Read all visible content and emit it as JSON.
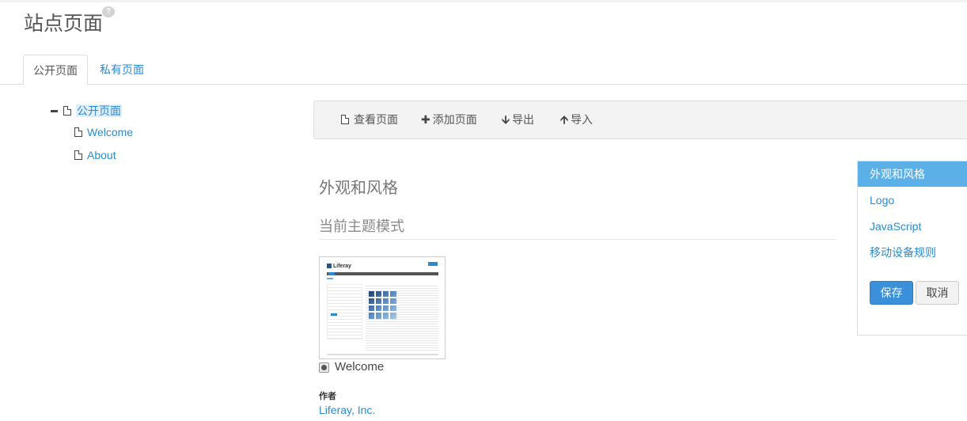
{
  "header": {
    "title": "站点页面",
    "help_icon": "?"
  },
  "tabs": [
    {
      "label": "公开页面",
      "active": true
    },
    {
      "label": "私有页面",
      "active": false
    }
  ],
  "tree": {
    "root": {
      "label": "公开页面",
      "icon": "document-icon",
      "expanded": true
    },
    "children": [
      {
        "label": "Welcome",
        "icon": "document-icon"
      },
      {
        "label": "About",
        "icon": "document-icon"
      }
    ]
  },
  "toolbar": {
    "view_page": {
      "label": "查看页面",
      "icon": "document-icon"
    },
    "add_page": {
      "label": "添加页面",
      "icon": "plus-icon"
    },
    "export": {
      "label": "导出",
      "icon": "arrow-down-icon"
    },
    "import": {
      "label": "导入",
      "icon": "arrow-up-icon"
    }
  },
  "main": {
    "section_title": "外观和风格",
    "subsection_title": "当前主题模式",
    "theme": {
      "name": "Welcome",
      "thumbnail_brand": "Liferay",
      "selected": true
    },
    "author_label": "作者",
    "author_value": "Liferay, Inc."
  },
  "side_panel": {
    "items": [
      {
        "label": "外观和风格",
        "active": true
      },
      {
        "label": "Logo",
        "active": false
      },
      {
        "label": "JavaScript",
        "active": false
      },
      {
        "label": "移动设备规则",
        "active": false
      }
    ],
    "save_label": "保存",
    "cancel_label": "取消"
  },
  "colors": {
    "link": "#2a8bd0",
    "active_panel": "#5bb0e8",
    "primary_button": "#3c8fd9"
  }
}
